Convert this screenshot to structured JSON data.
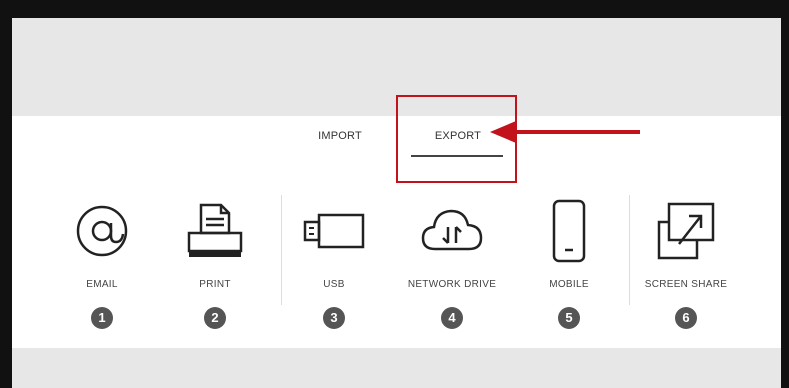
{
  "tabs": [
    {
      "label": "IMPORT",
      "selected": false
    },
    {
      "label": "EXPORT",
      "selected": true
    }
  ],
  "items": [
    {
      "label": "EMAIL",
      "number": "1",
      "icon": "at-sign-icon"
    },
    {
      "label": "PRINT",
      "number": "2",
      "icon": "printer-icon"
    },
    {
      "label": "USB",
      "number": "3",
      "icon": "usb-drive-icon"
    },
    {
      "label": "NETWORK DRIVE",
      "number": "4",
      "icon": "cloud-transfer-icon"
    },
    {
      "label": "MOBILE",
      "number": "5",
      "icon": "mobile-phone-icon"
    },
    {
      "label": "SCREEN SHARE",
      "number": "6",
      "icon": "screen-share-icon"
    }
  ],
  "colors": {
    "highlight": "#c2121b",
    "badge": "#555555",
    "panel_gray": "#e7e7e7"
  }
}
